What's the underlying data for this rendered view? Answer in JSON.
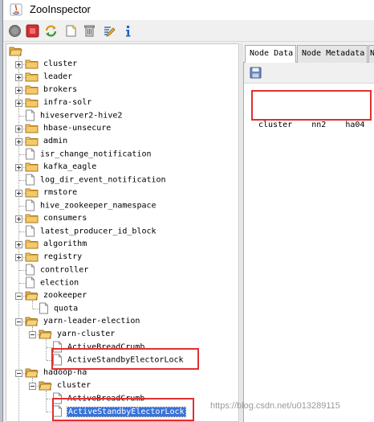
{
  "window": {
    "title": "ZooInspector"
  },
  "toolbar": {
    "buttons": [
      {
        "name": "connect-icon",
        "tooltip": ""
      },
      {
        "name": "disconnect-icon"
      },
      {
        "name": "refresh-icon"
      },
      {
        "name": "add-node-icon"
      },
      {
        "name": "delete-node-icon"
      },
      {
        "name": "edit-icon"
      },
      {
        "name": "info-icon"
      }
    ]
  },
  "tree": {
    "root_label": "",
    "nodes": [
      {
        "label": "cluster",
        "depth": 1,
        "expander": "collapsed"
      },
      {
        "label": "leader",
        "depth": 1,
        "expander": "collapsed"
      },
      {
        "label": "brokers",
        "depth": 1,
        "expander": "collapsed"
      },
      {
        "label": "infra-solr",
        "depth": 1,
        "expander": "collapsed"
      },
      {
        "label": "hiveserver2-hive2",
        "depth": 1,
        "expander": "none"
      },
      {
        "label": "hbase-unsecure",
        "depth": 1,
        "expander": "collapsed"
      },
      {
        "label": "admin",
        "depth": 1,
        "expander": "collapsed"
      },
      {
        "label": "isr_change_notification",
        "depth": 1,
        "expander": "none"
      },
      {
        "label": "kafka_eagle",
        "depth": 1,
        "expander": "collapsed"
      },
      {
        "label": "log_dir_event_notification",
        "depth": 1,
        "expander": "none"
      },
      {
        "label": "rmstore",
        "depth": 1,
        "expander": "collapsed"
      },
      {
        "label": "hive_zookeeper_namespace",
        "depth": 1,
        "expander": "none"
      },
      {
        "label": "consumers",
        "depth": 1,
        "expander": "collapsed"
      },
      {
        "label": "latest_producer_id_block",
        "depth": 1,
        "expander": "none"
      },
      {
        "label": "algorithm",
        "depth": 1,
        "expander": "collapsed"
      },
      {
        "label": "registry",
        "depth": 1,
        "expander": "collapsed"
      },
      {
        "label": "controller",
        "depth": 1,
        "expander": "none"
      },
      {
        "label": "election",
        "depth": 1,
        "expander": "none"
      },
      {
        "label": "zookeeper",
        "depth": 1,
        "expander": "expanded"
      },
      {
        "label": "quota",
        "depth": 2,
        "expander": "none"
      },
      {
        "label": "yarn-leader-election",
        "depth": 1,
        "expander": "expanded"
      },
      {
        "label": "yarn-cluster",
        "depth": 2,
        "expander": "expanded"
      },
      {
        "label": "ActiveBreadCrumb",
        "depth": 3,
        "expander": "none"
      },
      {
        "label": "ActiveStandbyElectorLock",
        "depth": 3,
        "expander": "none"
      },
      {
        "label": "hadoop-ha",
        "depth": 1,
        "expander": "expanded"
      },
      {
        "label": "cluster",
        "depth": 2,
        "expander": "expanded"
      },
      {
        "label": "ActiveBreadCrumb",
        "depth": 3,
        "expander": "none"
      },
      {
        "label": "ActiveStandbyElectorLock",
        "depth": 3,
        "expander": "none",
        "selected": true
      }
    ]
  },
  "tabs": [
    {
      "label": "Node Data",
      "active": true
    },
    {
      "label": "Node Metadata",
      "active": false
    },
    {
      "label": "N",
      "active": false
    }
  ],
  "node_data": {
    "text": "cluster    nn2    ha04"
  },
  "watermark": "https://blog.csdn.net/u013289115",
  "colors": {
    "highlight": "#e03030",
    "selection": "#3873d9",
    "folder": "#f3c96a"
  }
}
